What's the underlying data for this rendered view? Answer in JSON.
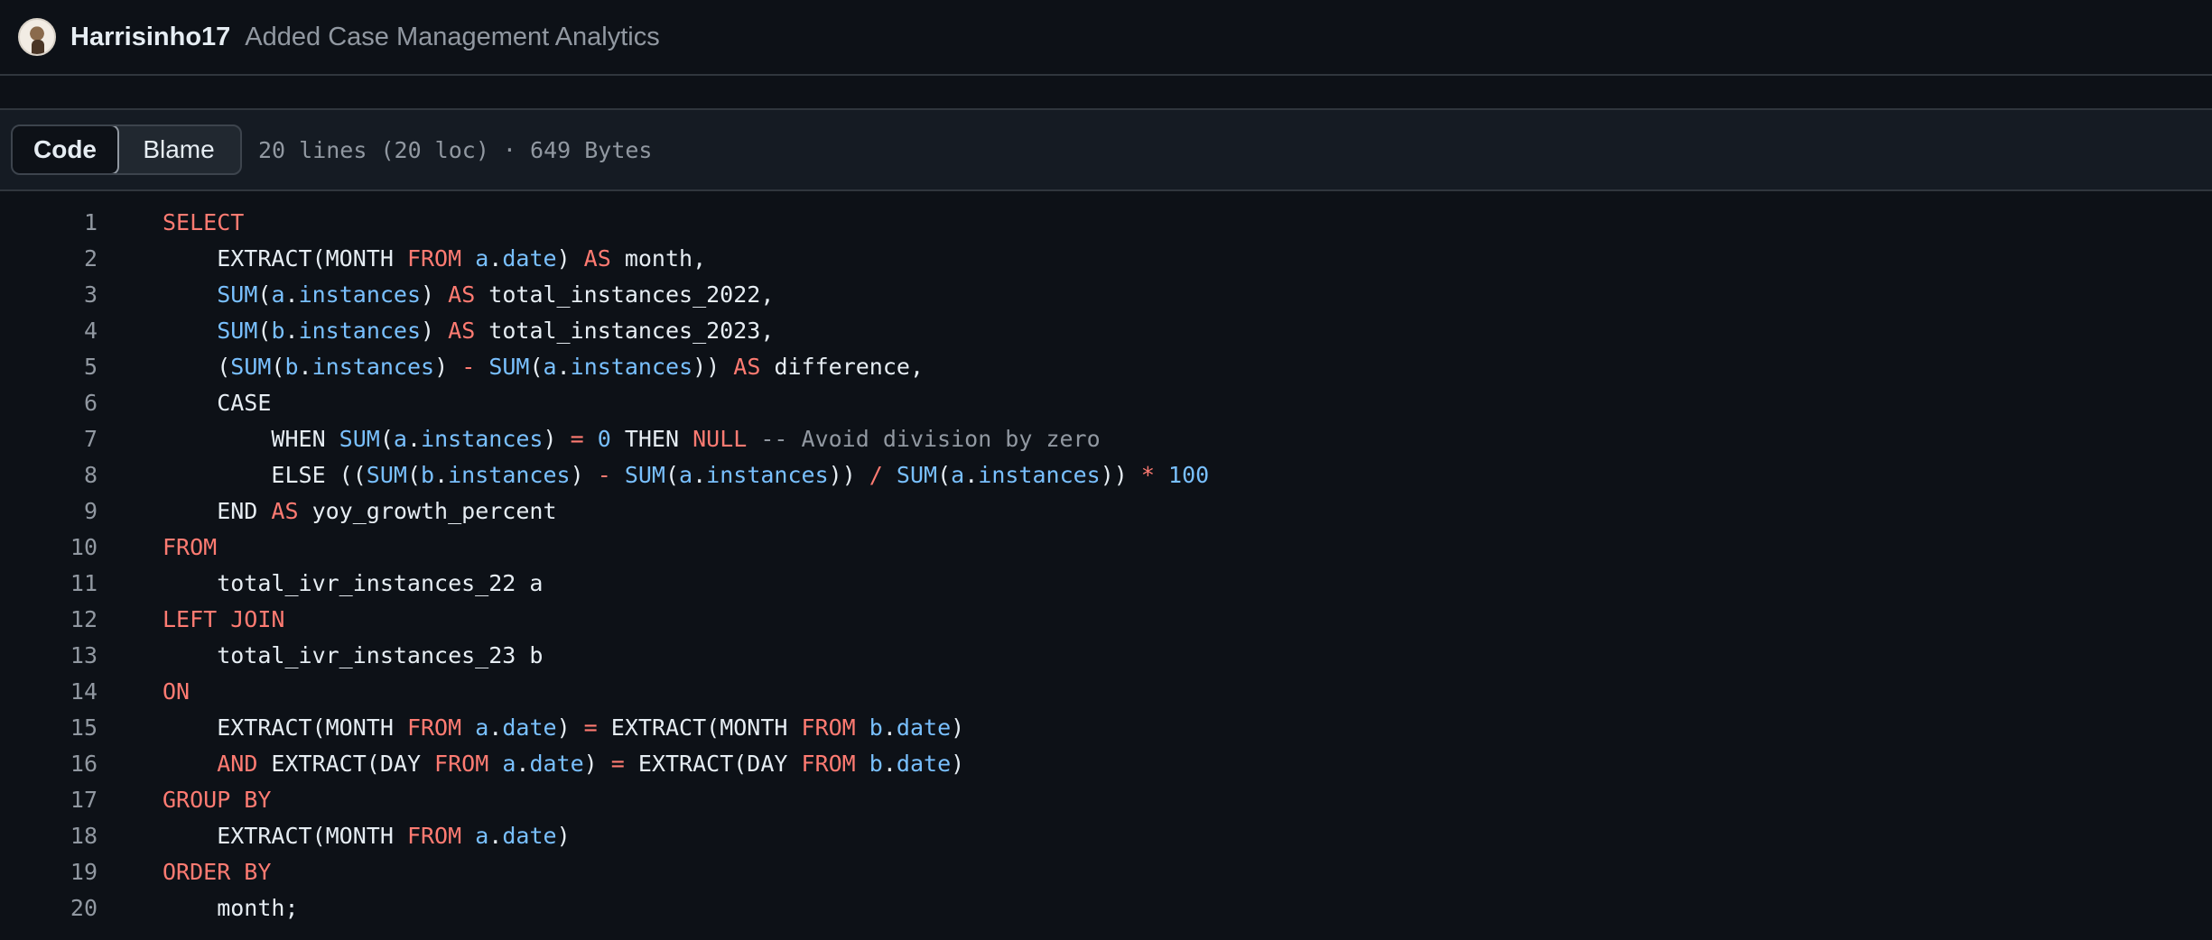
{
  "commit": {
    "author": "Harrisinho17",
    "message": "Added Case Management Analytics",
    "avatar_icon": "user-avatar"
  },
  "file_header": {
    "tabs": [
      "Code",
      "Blame"
    ],
    "active_tab": "Code",
    "info": "20 lines (20 loc) · 649 Bytes"
  },
  "colors": {
    "background": "#0d1117",
    "keyword": "#ff7b72",
    "identifier": "#79c0ff",
    "comment": "#9198a1",
    "text": "#e6edf3"
  },
  "code": {
    "line_numbers": [
      "1",
      "2",
      "3",
      "4",
      "5",
      "6",
      "7",
      "8",
      "9",
      "10",
      "11",
      "12",
      "13",
      "14",
      "15",
      "16",
      "17",
      "18",
      "19",
      "20"
    ],
    "tokens": {
      "l1": [
        "SELECT"
      ],
      "l2": [
        "    EXTRACT(MONTH ",
        "FROM",
        " ",
        "a",
        ".",
        "date",
        ") ",
        "AS",
        " month,"
      ],
      "l3": [
        "    ",
        "SUM",
        "(",
        "a",
        ".",
        "instances",
        ") ",
        "AS",
        " total_instances_2022,"
      ],
      "l4": [
        "    ",
        "SUM",
        "(",
        "b",
        ".",
        "instances",
        ") ",
        "AS",
        " total_instances_2023,"
      ],
      "l5": [
        "    (",
        "SUM",
        "(",
        "b",
        ".",
        "instances",
        ") ",
        "-",
        " ",
        "SUM",
        "(",
        "a",
        ".",
        "instances",
        ")) ",
        "AS",
        " difference,"
      ],
      "l6": [
        "    CASE"
      ],
      "l7": [
        "        WHEN ",
        "SUM",
        "(",
        "a",
        ".",
        "instances",
        ") ",
        "=",
        " ",
        "0",
        " THEN ",
        "NULL",
        " ",
        "-- Avoid division by zero"
      ],
      "l8": [
        "        ELSE ((",
        "SUM",
        "(",
        "b",
        ".",
        "instances",
        ") ",
        "-",
        " ",
        "SUM",
        "(",
        "a",
        ".",
        "instances",
        ")) ",
        "/",
        " ",
        "SUM",
        "(",
        "a",
        ".",
        "instances",
        ")) ",
        "*",
        " ",
        "100"
      ],
      "l9": [
        "    END ",
        "AS",
        " yoy_growth_percent"
      ],
      "l10": [
        "FROM"
      ],
      "l11": [
        "    total_ivr_instances_22 a"
      ],
      "l12": [
        "LEFT JOIN"
      ],
      "l13": [
        "    total_ivr_instances_23 b"
      ],
      "l14": [
        "ON"
      ],
      "l15": [
        "    EXTRACT(MONTH ",
        "FROM",
        " ",
        "a",
        ".",
        "date",
        ") ",
        "=",
        " EXTRACT(MONTH ",
        "FROM",
        " ",
        "b",
        ".",
        "date",
        ")"
      ],
      "l16": [
        "    ",
        "AND",
        " EXTRACT(DAY ",
        "FROM",
        " ",
        "a",
        ".",
        "date",
        ") ",
        "=",
        " EXTRACT(DAY ",
        "FROM",
        " ",
        "b",
        ".",
        "date",
        ")"
      ],
      "l17": [
        "GROUP BY"
      ],
      "l18": [
        "    EXTRACT(MONTH ",
        "FROM",
        " ",
        "a",
        ".",
        "date",
        ")"
      ],
      "l19": [
        "ORDER BY"
      ],
      "l20": [
        "    month;"
      ]
    }
  }
}
